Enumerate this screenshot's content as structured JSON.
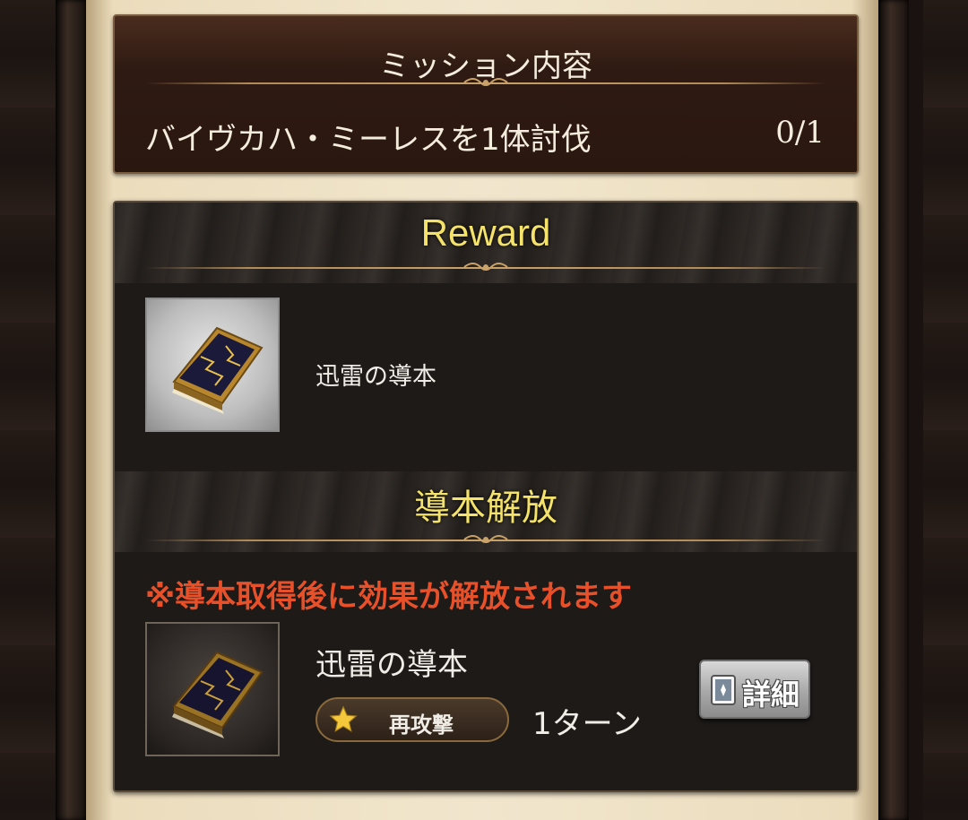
{
  "mission": {
    "header": "ミッション内容",
    "description": "バイヴカハ・ミーレスを1体討伐",
    "progress": "0/1"
  },
  "reward": {
    "header": "Reward",
    "item": {
      "name": "迅雷の導本",
      "icon": "lightning-tome-icon"
    }
  },
  "unlock": {
    "header": "導本解放",
    "notice": "※導本取得後に効果が解放されます",
    "item": {
      "name": "迅雷の導本",
      "icon": "lightning-tome-icon"
    },
    "skill": {
      "icon": "star-icon",
      "label": "再攻撃",
      "value": "1ターン"
    },
    "detail_button": {
      "icon": "card-icon",
      "label": "詳細"
    }
  },
  "colors": {
    "header_gold": "#f4e26a",
    "notice_red": "#e8502a",
    "parchment": "#f1e6cd",
    "mission_bg": "#2e1a12"
  }
}
